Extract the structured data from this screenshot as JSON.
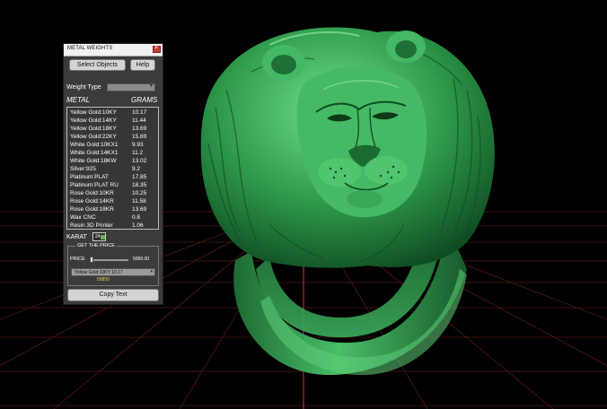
{
  "colors": {
    "ring": "#2f9448",
    "ring_highlight": "#5fd07a",
    "ring_shadow": "#0d4a1f",
    "grid": "#7a2222",
    "panel_bg": "#3b3b3b"
  },
  "panel": {
    "title": "METAL WEIGHTS",
    "close_icon": "×",
    "select_objects": "Select Objects",
    "help": "Help",
    "weight_type_label": "Weight Type",
    "col_metal": "METAL",
    "col_grams": "GRAMS",
    "rows": [
      {
        "metal": "Yellow Gold:10KY",
        "grams": "10.17"
      },
      {
        "metal": "Yellow Gold:14KY",
        "grams": "11.44"
      },
      {
        "metal": "Yellow Gold:18KY",
        "grams": "13.69"
      },
      {
        "metal": "Yellow Gold:22KY",
        "grams": "15.89"
      },
      {
        "metal": "White Gold:10KX1",
        "grams": "9.93"
      },
      {
        "metal": "White Gold:14KX1",
        "grams": "11.2"
      },
      {
        "metal": "White Gold:18KW",
        "grams": "13.02"
      },
      {
        "metal": "Silver:925",
        "grams": "9.2"
      },
      {
        "metal": "Platinum:PLAT",
        "grams": "17.85"
      },
      {
        "metal": "Platinum:PLAT RU",
        "grams": "18.35"
      },
      {
        "metal": "Rose Gold:10KR",
        "grams": "10.25"
      },
      {
        "metal": "Rose Gold:14KR",
        "grams": "11.58"
      },
      {
        "metal": "Rose Gold:18KR",
        "grams": "13.69"
      },
      {
        "metal": "Wax  CNC",
        "grams": "0.8"
      },
      {
        "metal": "Resin 3D Printer",
        "grams": "1.06"
      }
    ],
    "karat_label": "KARAT",
    "karat_value": "24",
    "get_price": "GET THE PRICE",
    "price_label": "PRICE",
    "price_max": "5000.00",
    "price_select": "Yellow Gold:10KY 10.17",
    "price_result": "50850",
    "copy_text": "Copy Text"
  }
}
